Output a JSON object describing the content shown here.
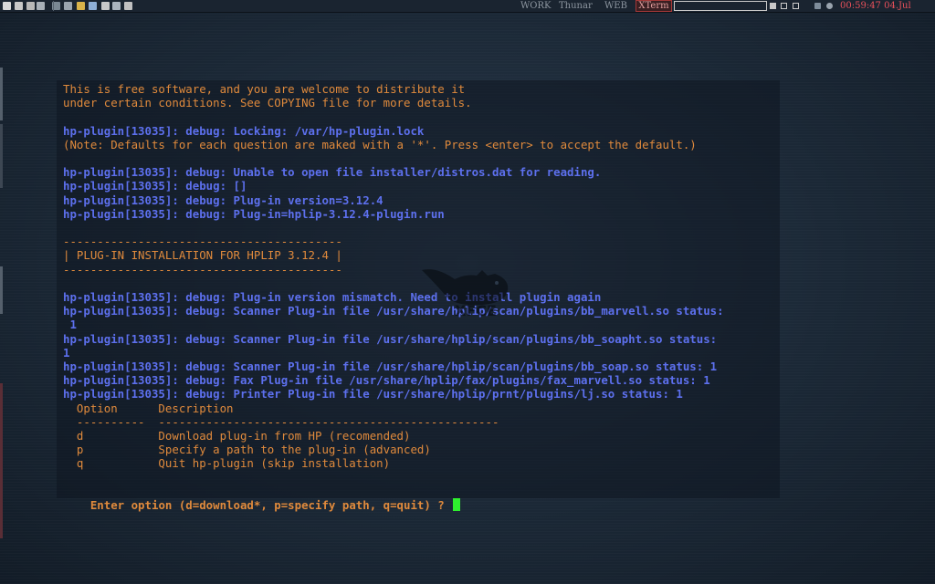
{
  "panel": {
    "workspaces": [
      "WORK",
      "Thunar",
      "WEB",
      "XTerm"
    ],
    "clock": "00:59:47 04.Jul",
    "launcher_icons": [
      "terminal-icon",
      "search-icon",
      "window-icon",
      "editor-icon",
      "app-icon",
      "app-icon",
      "folder-icon",
      "browser-icon",
      "mail-icon",
      "settings-icon",
      "document-icon"
    ]
  },
  "terminal": {
    "lines": [
      {
        "text": "This is free software, and you are welcome to distribute it",
        "style": "orange"
      },
      {
        "text": "under certain conditions. See COPYING file for more details.",
        "style": "orange"
      },
      {
        "text": "",
        "style": "orange"
      },
      {
        "text": "hp-plugin[13035]: debug: Locking: /var/hp-plugin.lock",
        "style": "blue"
      },
      {
        "text": "(Note: Defaults for each question are maked with a '*'. Press <enter> to accept the default.)",
        "style": "orange"
      },
      {
        "text": "",
        "style": "orange"
      },
      {
        "text": "hp-plugin[13035]: debug: Unable to open file installer/distros.dat for reading.",
        "style": "blue"
      },
      {
        "text": "hp-plugin[13035]: debug: []",
        "style": "blue"
      },
      {
        "text": "hp-plugin[13035]: debug: Plug-in version=3.12.4",
        "style": "blue"
      },
      {
        "text": "hp-plugin[13035]: debug: Plug-in=hplip-3.12.4-plugin.run",
        "style": "blue"
      },
      {
        "text": "",
        "style": "orange"
      },
      {
        "text": "-----------------------------------------",
        "style": "orange"
      },
      {
        "text": "| PLUG-IN INSTALLATION FOR HPLIP 3.12.4 |",
        "style": "orange"
      },
      {
        "text": "-----------------------------------------",
        "style": "orange"
      },
      {
        "text": "",
        "style": "orange"
      },
      {
        "text": "hp-plugin[13035]: debug: Plug-in version mismatch. Need to install plugin again",
        "style": "blue"
      },
      {
        "text": "hp-plugin[13035]: debug: Scanner Plug-in file /usr/share/hplip/scan/plugins/bb_marvell.so status:",
        "style": "blue"
      },
      {
        "text": " 1",
        "style": "blue"
      },
      {
        "text": "hp-plugin[13035]: debug: Scanner Plug-in file /usr/share/hplip/scan/plugins/bb_soapht.so status:",
        "style": "blue"
      },
      {
        "text": "1",
        "style": "blue"
      },
      {
        "text": "hp-plugin[13035]: debug: Scanner Plug-in file /usr/share/hplip/scan/plugins/bb_soap.so status: 1",
        "style": "blue"
      },
      {
        "text": "hp-plugin[13035]: debug: Fax Plug-in file /usr/share/hplip/fax/plugins/fax_marvell.so status: 1",
        "style": "blue"
      },
      {
        "text": "hp-plugin[13035]: debug: Printer Plug-in file /usr/share/hplip/prnt/plugins/lj.so status: 1",
        "style": "blue"
      },
      {
        "text": "  Option      Description",
        "style": "orange"
      },
      {
        "text": "  ----------  --------------------------------------------------",
        "style": "orange"
      },
      {
        "text": "  d           Download plug-in from HP (recomended)",
        "style": "orange"
      },
      {
        "text": "  p           Specify a path to the plug-in (advanced)",
        "style": "orange"
      },
      {
        "text": "  q           Quit hp-plugin (skip installation)",
        "style": "orange"
      },
      {
        "text": "",
        "style": "orange"
      }
    ],
    "prompt": "Enter option (d=download*, p=specify path, q=quit) ? "
  },
  "colors": {
    "orange_text": "#e08a3c",
    "blue_text": "#5d70ee",
    "cursor": "#2ef02e",
    "clock": "#e8505a"
  }
}
